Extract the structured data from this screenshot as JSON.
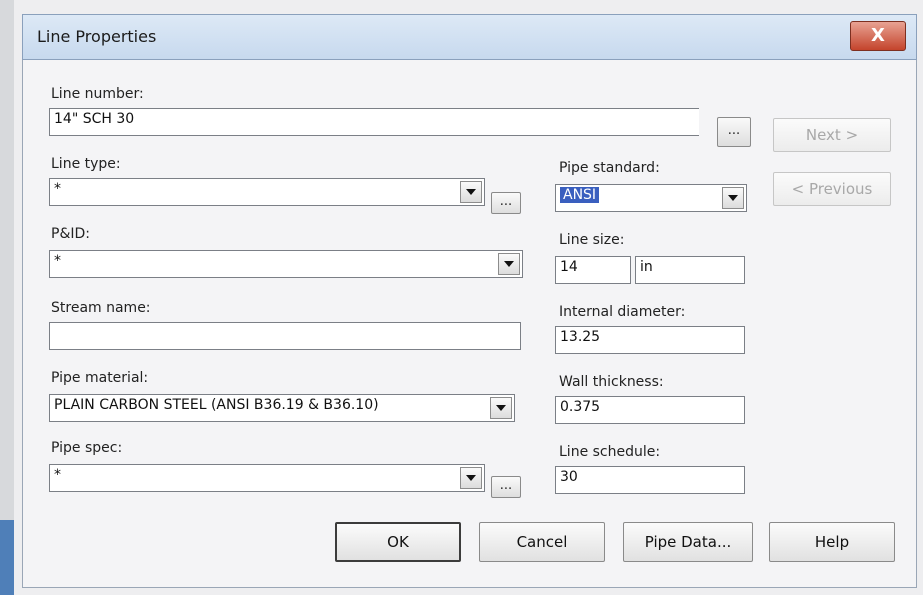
{
  "window": {
    "title": "Line Properties",
    "close_glyph": "X"
  },
  "fields": {
    "line_number": {
      "label": "Line number:",
      "value": "14\" SCH 30"
    },
    "line_type": {
      "label": "Line type:",
      "value": "*"
    },
    "pid": {
      "label": "P&ID:",
      "value": "*"
    },
    "stream_name": {
      "label": "Stream name:",
      "value": ""
    },
    "pipe_material": {
      "label": "Pipe material:",
      "value": "PLAIN CARBON STEEL (ANSI B36.19 & B36.10)"
    },
    "pipe_spec": {
      "label": "Pipe spec:",
      "value": "*"
    },
    "pipe_standard": {
      "label": "Pipe standard:",
      "value": "ANSI"
    },
    "line_size": {
      "label": "Line size:",
      "value": "14",
      "unit": "in"
    },
    "internal_diameter": {
      "label": "Internal diameter:",
      "value": "13.25"
    },
    "wall_thickness": {
      "label": "Wall thickness:",
      "value": "0.375"
    },
    "line_schedule": {
      "label": "Line schedule:",
      "value": "30"
    }
  },
  "buttons": {
    "next": "Next >",
    "previous": "< Previous",
    "ellipsis": "...",
    "ok": "OK",
    "cancel": "Cancel",
    "pipe_data": "Pipe Data...",
    "help": "Help"
  }
}
